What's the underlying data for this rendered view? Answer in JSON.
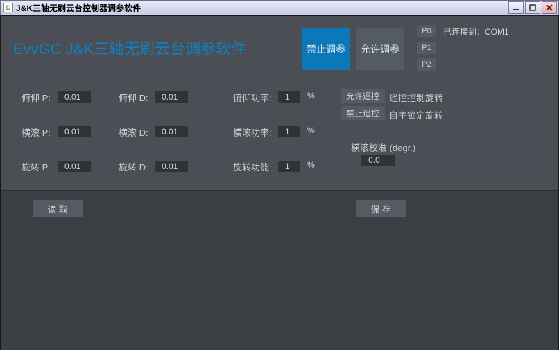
{
  "window": {
    "icon_letter": "D",
    "title": "J&K三轴无刷云台控制器调参软件"
  },
  "header": {
    "app_title": "EvvGC J&K三轴无刷云台调参软件",
    "btn_disable": "禁止调参",
    "btn_enable": "允许调参",
    "ports": [
      "P0",
      "P1",
      "P2"
    ],
    "connected": "已连接到：COM1"
  },
  "params": {
    "rows": [
      {
        "pl": "俯仰 P:",
        "pv": "0.01",
        "dl": "俯仰 D:",
        "dv": "0.01",
        "pw_l": "俯仰功率:",
        "pw_v": "1"
      },
      {
        "pl": "横滚 P:",
        "pv": "0.01",
        "dl": "横滚 D:",
        "dv": "0.01",
        "pw_l": "横滚功率:",
        "pw_v": "1"
      },
      {
        "pl": "旋转 P:",
        "pv": "0.01",
        "dl": "旋转 D:",
        "dv": "0.01",
        "pw_l": "旋转功能:",
        "pw_v": "1"
      }
    ],
    "pct": "%",
    "btn_allow_rc": "允许遥控",
    "txt_rc_ctrl": "遥控控制旋转",
    "btn_deny_rc": "禁止遥控",
    "txt_auto_lock": "自主锁定旋转",
    "calib_label": "横滚校准 (degr.)",
    "calib_value": "0.0"
  },
  "actions": {
    "read": "读 取",
    "save": "保 存"
  }
}
